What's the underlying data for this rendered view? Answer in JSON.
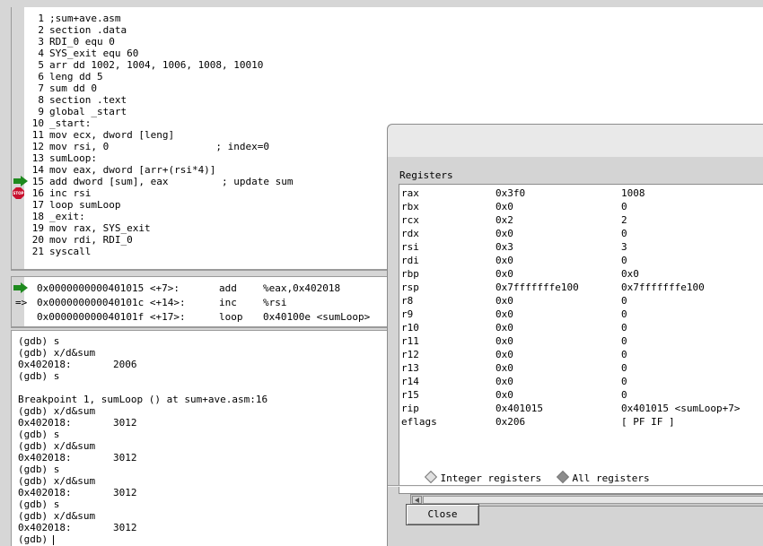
{
  "source": {
    "lines": [
      {
        "num": "1",
        "code": ";sum+ave.asm"
      },
      {
        "num": "2",
        "code": "section .data"
      },
      {
        "num": "3",
        "code": "RDI_0 equ 0"
      },
      {
        "num": "4",
        "code": "SYS_exit equ 60"
      },
      {
        "num": "5",
        "code": "arr dd 1002, 1004, 1006, 1008, 10010"
      },
      {
        "num": "6",
        "code": "leng dd 5"
      },
      {
        "num": "7",
        "code": "sum dd 0"
      },
      {
        "num": "8",
        "code": "section .text"
      },
      {
        "num": "9",
        "code": "global _start"
      },
      {
        "num": "10",
        "code": "_start:"
      },
      {
        "num": "11",
        "code": "mov ecx, dword [leng]"
      },
      {
        "num": "12",
        "code": "mov rsi, 0                  ; index=0"
      },
      {
        "num": "13",
        "code": "sumLoop:"
      },
      {
        "num": "14",
        "code": "mov eax, dword [arr+(rsi*4)]"
      },
      {
        "num": "15",
        "code": "add dword [sum], eax         ; update sum"
      },
      {
        "num": "16",
        "code": "inc rsi"
      },
      {
        "num": "17",
        "code": "loop sumLoop"
      },
      {
        "num": "18",
        "code": "_exit:"
      },
      {
        "num": "19",
        "code": "mov rax, SYS_exit"
      },
      {
        "num": "20",
        "code": "mov rdi, RDI_0"
      },
      {
        "num": "21",
        "code": "syscall"
      }
    ],
    "current_line_marker": "green-arrow",
    "breakpoint_marker": "STOP"
  },
  "disassembly": {
    "rows": [
      {
        "prefix": "",
        "addr": "0x0000000000401015 <+7>:",
        "op": "add",
        "args": "%eax,0x402018",
        "marker": "arrow"
      },
      {
        "prefix": "=>",
        "addr": "0x000000000040101c <+14>:",
        "op": "inc",
        "args": "%rsi",
        "marker": ""
      },
      {
        "prefix": "",
        "addr": "0x000000000040101f <+17>:",
        "op": "loop",
        "args": "0x40100e <sumLoop>",
        "marker": ""
      }
    ]
  },
  "console": {
    "lines": [
      "(gdb) s",
      "(gdb) x/d&sum",
      "0x402018:       2006",
      "(gdb) s",
      "",
      "Breakpoint 1, sumLoop () at sum+ave.asm:16",
      "(gdb) x/d&sum",
      "0x402018:       3012",
      "(gdb) s",
      "(gdb) x/d&sum",
      "0x402018:       3012",
      "(gdb) s",
      "(gdb) x/d&sum",
      "0x402018:       3012",
      "(gdb) s",
      "(gdb) x/d&sum",
      "0x402018:       3012",
      "(gdb)"
    ]
  },
  "registers_dialog": {
    "title": "Registers",
    "rows": [
      {
        "name": "rax",
        "hex": "0x3f0",
        "value": "1008"
      },
      {
        "name": "rbx",
        "hex": "0x0",
        "value": "0"
      },
      {
        "name": "rcx",
        "hex": "0x2",
        "value": "2"
      },
      {
        "name": "rdx",
        "hex": "0x0",
        "value": "0"
      },
      {
        "name": "rsi",
        "hex": "0x3",
        "value": "3"
      },
      {
        "name": "rdi",
        "hex": "0x0",
        "value": "0"
      },
      {
        "name": "rbp",
        "hex": "0x0",
        "value": "0x0"
      },
      {
        "name": "rsp",
        "hex": "0x7fffffffe100",
        "value": "0x7fffffffe100"
      },
      {
        "name": "r8",
        "hex": "0x0",
        "value": "0"
      },
      {
        "name": "r9",
        "hex": "0x0",
        "value": "0"
      },
      {
        "name": "r10",
        "hex": "0x0",
        "value": "0"
      },
      {
        "name": "r11",
        "hex": "0x0",
        "value": "0"
      },
      {
        "name": "r12",
        "hex": "0x0",
        "value": "0"
      },
      {
        "name": "r13",
        "hex": "0x0",
        "value": "0"
      },
      {
        "name": "r14",
        "hex": "0x0",
        "value": "0"
      },
      {
        "name": "r15",
        "hex": "0x0",
        "value": "0"
      },
      {
        "name": "rip",
        "hex": "0x401015",
        "value": "0x401015 <sumLoop+7>"
      },
      {
        "name": "eflags",
        "hex": "0x206",
        "value": "[ PF IF ]"
      }
    ],
    "options": {
      "integer_label": "Integer registers",
      "all_label": "All registers",
      "selected": "all"
    },
    "close_label": "Close"
  },
  "colors": {
    "arrow": "#1e8a1e",
    "stop": "#c8102e",
    "pane_bg": "#ffffff",
    "chrome_bg": "#d6d6d6"
  }
}
